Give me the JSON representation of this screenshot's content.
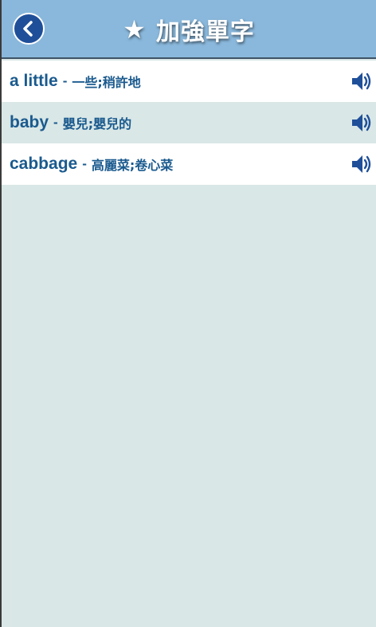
{
  "header": {
    "title": "加強單字",
    "star_glyph": "★",
    "back_icon": "chevron-left-icon",
    "color": "#8ab8dc"
  },
  "words": [
    {
      "word": "a little",
      "separator": "-",
      "meaning": "一些;稍許地",
      "icon": "speaker-icon"
    },
    {
      "word": "baby",
      "separator": "-",
      "meaning": "嬰兒;嬰兒的",
      "icon": "speaker-icon"
    },
    {
      "word": "cabbage",
      "separator": "-",
      "meaning": "高麗菜;卷心菜",
      "icon": "speaker-icon"
    }
  ],
  "colors": {
    "accent": "#1f4f99",
    "text": "#1a5a8e",
    "background": "#d9e7e6",
    "row_white": "#ffffff"
  }
}
